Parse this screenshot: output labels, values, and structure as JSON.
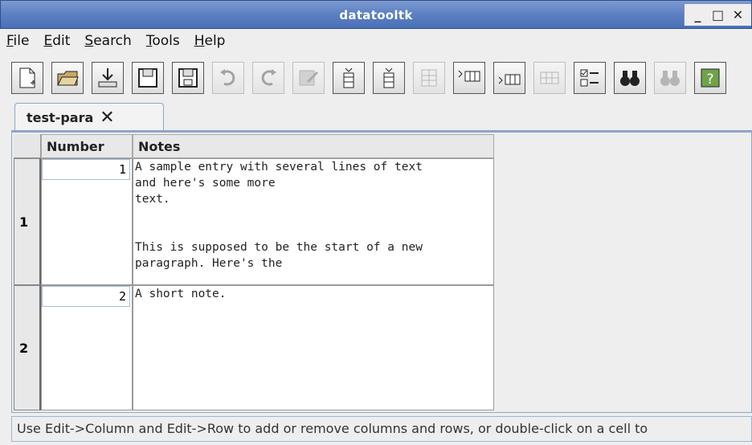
{
  "window": {
    "title": "datatooltk",
    "minimize": "_",
    "maximize": "□",
    "close": "✕"
  },
  "menu": [
    {
      "label_u": "F",
      "label_rest": "ile"
    },
    {
      "label_u": "E",
      "label_rest": "dit"
    },
    {
      "label_u": "S",
      "label_rest": "earch"
    },
    {
      "label_u": "T",
      "label_rest": "ools"
    },
    {
      "label_u": "H",
      "label_rest": "elp"
    }
  ],
  "toolbar": [
    {
      "icon": "new-file-icon",
      "enabled": true
    },
    {
      "icon": "open-folder-icon",
      "enabled": true
    },
    {
      "icon": "import-icon",
      "enabled": true
    },
    {
      "icon": "save-icon",
      "enabled": true
    },
    {
      "icon": "save-as-icon",
      "enabled": true
    },
    {
      "icon": "undo-icon",
      "enabled": false
    },
    {
      "icon": "redo-icon",
      "enabled": false
    },
    {
      "icon": "edit-cell-icon",
      "enabled": false
    },
    {
      "icon": "insert-column-before-icon",
      "enabled": true
    },
    {
      "icon": "insert-column-after-icon",
      "enabled": true
    },
    {
      "icon": "remove-column-icon",
      "enabled": false
    },
    {
      "icon": "insert-row-before-icon",
      "enabled": true
    },
    {
      "icon": "insert-row-after-icon",
      "enabled": true
    },
    {
      "icon": "remove-row-icon",
      "enabled": false
    },
    {
      "icon": "properties-icon",
      "enabled": true
    },
    {
      "icon": "find-icon",
      "enabled": true
    },
    {
      "icon": "find-again-icon",
      "enabled": false
    },
    {
      "icon": "help-icon",
      "enabled": true
    }
  ],
  "tab": {
    "label": "test-para",
    "close": "✕"
  },
  "table": {
    "headers": [
      "Number",
      "Notes"
    ],
    "rows": [
      {
        "row_label": "1",
        "number": "1",
        "notes": "A sample entry with several lines of text\nand here's some more\ntext.\n\n\nThis is supposed to be the start of a new\nparagraph. Here's the"
      },
      {
        "row_label": "2",
        "number": "2",
        "notes": "A short note."
      }
    ]
  },
  "status": "Use Edit->Column and Edit->Row to add or remove columns and rows, or double-click on a cell to"
}
